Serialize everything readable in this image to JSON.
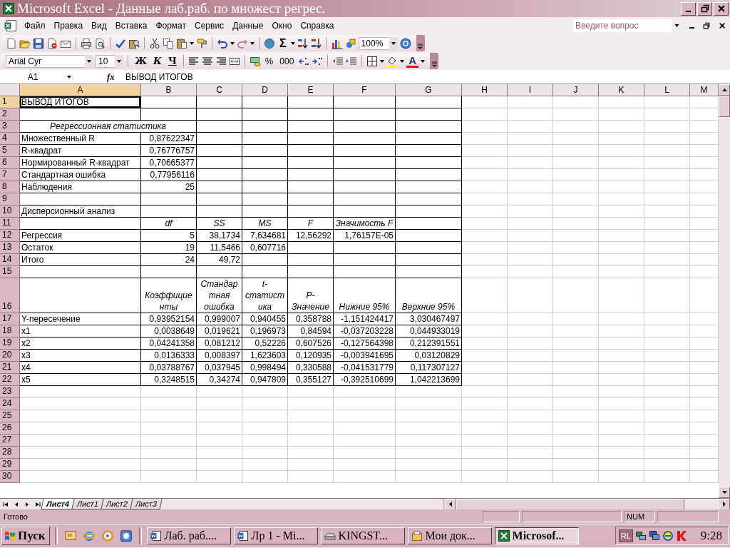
{
  "window": {
    "title": "Microsoft Excel - Данные лаб.раб. по множест регрес."
  },
  "menu": [
    "Файл",
    "Правка",
    "Вид",
    "Вставка",
    "Формат",
    "Сервис",
    "Данные",
    "Окно",
    "Справка"
  ],
  "help_box": {
    "placeholder": "Введите вопрос"
  },
  "standard_toolbar": {
    "sum": "Σ",
    "zoom": "100%"
  },
  "formatting_toolbar": {
    "font": "Arial Cyr",
    "size": "10",
    "bold": "Ж",
    "italic": "К",
    "underline": "Ч",
    "percent": "%",
    "thousands": "000",
    "font_color": "A"
  },
  "formula_bar": {
    "name_box": "A1",
    "function_label": "fx",
    "value": "ВЫВОД ИТОГОВ"
  },
  "sheet": {
    "columns": [
      {
        "label": "A",
        "selected": true
      },
      {
        "label": "B",
        "selected": false
      },
      {
        "label": "C",
        "selected": false
      },
      {
        "label": "D",
        "selected": false
      },
      {
        "label": "E",
        "selected": false
      },
      {
        "label": "F",
        "selected": false
      },
      {
        "label": "G",
        "selected": false
      },
      {
        "label": "H",
        "selected": false
      },
      {
        "label": "I",
        "selected": false
      },
      {
        "label": "J",
        "selected": false
      },
      {
        "label": "K",
        "selected": false
      },
      {
        "label": "L",
        "selected": false
      },
      {
        "label": "M",
        "selected": false
      }
    ],
    "rows": [
      {
        "number": "1",
        "selected": true,
        "framed": true,
        "cells": [
          {
            "text": "ВЫВОД ИТОГОВ",
            "kind": "text",
            "selected": true
          }
        ]
      },
      {
        "number": "2",
        "selected": false,
        "framed": true
      },
      {
        "number": "3",
        "selected": false,
        "framed": true,
        "cells": [
          {
            "text": "Регрессионная статистика",
            "kind": "title",
            "selected": false
          }
        ]
      },
      {
        "number": "4",
        "selected": false,
        "framed": true,
        "cells": [
          {
            "text": "Множественный R",
            "kind": "text",
            "selected": false
          },
          {
            "text": "0,87622347",
            "kind": "number",
            "selected": false
          }
        ]
      },
      {
        "number": "5",
        "selected": false,
        "framed": true,
        "cells": [
          {
            "text": "R-квадрат",
            "kind": "text",
            "selected": false
          },
          {
            "text": "0,76776757",
            "kind": "number",
            "selected": false
          }
        ]
      },
      {
        "number": "6",
        "selected": false,
        "framed": true,
        "cells": [
          {
            "text": "Нормированный R-квадрат",
            "kind": "text",
            "selected": false
          },
          {
            "text": "0,70665377",
            "kind": "number",
            "selected": false
          }
        ]
      },
      {
        "number": "7",
        "selected": false,
        "framed": true,
        "cells": [
          {
            "text": "Стандартная ошибка",
            "kind": "text",
            "selected": false
          },
          {
            "text": "0,77956116",
            "kind": "number",
            "selected": false
          }
        ]
      },
      {
        "number": "8",
        "selected": false,
        "framed": true,
        "cells": [
          {
            "text": "Наблюдения",
            "kind": "text",
            "selected": false
          },
          {
            "text": "25",
            "kind": "number",
            "selected": false
          }
        ]
      },
      {
        "number": "9",
        "selected": false,
        "framed": true
      },
      {
        "number": "10",
        "selected": false,
        "framed": true,
        "cells": [
          {
            "text": "Дисперсионный анализ",
            "kind": "text",
            "selected": false
          }
        ]
      },
      {
        "number": "11",
        "selected": false,
        "framed": true,
        "cells": [
          {
            "text": "",
            "kind": "text",
            "selected": false
          },
          {
            "text": "df",
            "kind": "heading",
            "selected": false
          },
          {
            "text": "SS",
            "kind": "heading",
            "selected": false
          },
          {
            "text": "MS",
            "kind": "heading",
            "selected": false
          },
          {
            "text": "F",
            "kind": "heading",
            "selected": false
          },
          {
            "text": "Значимость F",
            "kind": "heading",
            "selected": false
          }
        ]
      },
      {
        "number": "12",
        "selected": false,
        "framed": true,
        "cells": [
          {
            "text": "Регрессия",
            "kind": "text",
            "selected": false
          },
          {
            "text": "5",
            "kind": "number",
            "selected": false
          },
          {
            "text": "38,1734",
            "kind": "number",
            "selected": false
          },
          {
            "text": "7,634681",
            "kind": "number",
            "selected": false
          },
          {
            "text": "12,56292",
            "kind": "number",
            "selected": false
          },
          {
            "text": "1,76157E-05",
            "kind": "number",
            "selected": false
          }
        ]
      },
      {
        "number": "13",
        "selected": false,
        "framed": true,
        "cells": [
          {
            "text": "Остаток",
            "kind": "text",
            "selected": false
          },
          {
            "text": "19",
            "kind": "number",
            "selected": false
          },
          {
            "text": "11,5466",
            "kind": "number",
            "selected": false
          },
          {
            "text": "0,607716",
            "kind": "number",
            "selected": false
          }
        ]
      },
      {
        "number": "14",
        "selected": false,
        "framed": true,
        "cells": [
          {
            "text": "Итого",
            "kind": "text",
            "selected": false
          },
          {
            "text": "24",
            "kind": "number",
            "selected": false
          },
          {
            "text": "49,72",
            "kind": "number",
            "selected": false
          }
        ]
      },
      {
        "number": "15",
        "selected": false,
        "framed": true
      },
      {
        "number": "16",
        "selected": false,
        "framed": true,
        "cells": [
          {
            "text": "",
            "kind": "text",
            "selected": false
          },
          {
            "text": "Коэффициенты",
            "kind": "heading",
            "selected": false
          },
          {
            "text": "Стандартная ошибка",
            "kind": "heading",
            "selected": false
          },
          {
            "text": "t-статистика",
            "kind": "heading",
            "selected": false
          },
          {
            "text": "P-Значение",
            "kind": "heading",
            "selected": false
          },
          {
            "text": "Нижние 95%",
            "kind": "heading",
            "selected": false
          },
          {
            "text": "Верхние 95%",
            "kind": "heading",
            "selected": false
          }
        ]
      },
      {
        "number": "17",
        "selected": false,
        "framed": true,
        "cells": [
          {
            "text": "Y-пересечение",
            "kind": "text",
            "selected": false
          },
          {
            "text": "0,93952154",
            "kind": "number",
            "selected": false
          },
          {
            "text": "0,999007",
            "kind": "number",
            "selected": false
          },
          {
            "text": "0,940455",
            "kind": "number",
            "selected": false
          },
          {
            "text": "0,358788",
            "kind": "number",
            "selected": false
          },
          {
            "text": "-1,151424417",
            "kind": "number",
            "selected": false
          },
          {
            "text": "3,030467497",
            "kind": "number",
            "selected": false
          }
        ]
      },
      {
        "number": "18",
        "selected": false,
        "framed": true,
        "cells": [
          {
            "text": "x1",
            "kind": "text",
            "selected": false
          },
          {
            "text": "0,0038649",
            "kind": "number",
            "selected": false
          },
          {
            "text": "0,019621",
            "kind": "number",
            "selected": false
          },
          {
            "text": "0,196973",
            "kind": "number",
            "selected": false
          },
          {
            "text": "0,84594",
            "kind": "number",
            "selected": false
          },
          {
            "text": "-0,037203228",
            "kind": "number",
            "selected": false
          },
          {
            "text": "0,044933019",
            "kind": "number",
            "selected": false
          }
        ]
      },
      {
        "number": "19",
        "selected": false,
        "framed": true,
        "cells": [
          {
            "text": "x2",
            "kind": "text",
            "selected": false
          },
          {
            "text": "0,04241358",
            "kind": "number",
            "selected": false
          },
          {
            "text": "0,081212",
            "kind": "number",
            "selected": false
          },
          {
            "text": "0,52226",
            "kind": "number",
            "selected": false
          },
          {
            "text": "0,607526",
            "kind": "number",
            "selected": false
          },
          {
            "text": "-0,127564398",
            "kind": "number",
            "selected": false
          },
          {
            "text": "0,212391551",
            "kind": "number",
            "selected": false
          }
        ]
      },
      {
        "number": "20",
        "selected": false,
        "framed": true,
        "cells": [
          {
            "text": "x3",
            "kind": "text",
            "selected": false
          },
          {
            "text": "0,0136333",
            "kind": "number",
            "selected": false
          },
          {
            "text": "0,008397",
            "kind": "number",
            "selected": false
          },
          {
            "text": "1,623603",
            "kind": "number",
            "selected": false
          },
          {
            "text": "0,120935",
            "kind": "number",
            "selected": false
          },
          {
            "text": "-0,003941695",
            "kind": "number",
            "selected": false
          },
          {
            "text": "0,03120829",
            "kind": "number",
            "selected": false
          }
        ]
      },
      {
        "number": "21",
        "selected": false,
        "framed": true,
        "cells": [
          {
            "text": "x4",
            "kind": "text",
            "selected": false
          },
          {
            "text": "0,03788767",
            "kind": "number",
            "selected": false
          },
          {
            "text": "0,037945",
            "kind": "number",
            "selected": false
          },
          {
            "text": "0,998494",
            "kind": "number",
            "selected": false
          },
          {
            "text": "0,330588",
            "kind": "number",
            "selected": false
          },
          {
            "text": "-0,041531779",
            "kind": "number",
            "selected": false
          },
          {
            "text": "0,117307127",
            "kind": "number",
            "selected": false
          }
        ]
      },
      {
        "number": "22",
        "selected": false,
        "framed": true,
        "cells": [
          {
            "text": "x5",
            "kind": "text",
            "selected": false
          },
          {
            "text": "0,3248515",
            "kind": "number",
            "selected": false
          },
          {
            "text": "0,34274",
            "kind": "number",
            "selected": false
          },
          {
            "text": "0,947809",
            "kind": "number",
            "selected": false
          },
          {
            "text": "0,355127",
            "kind": "number",
            "selected": false
          },
          {
            "text": "-0,392510699",
            "kind": "number",
            "selected": false
          },
          {
            "text": "1,042213699",
            "kind": "number",
            "selected": false
          }
        ]
      },
      {
        "number": "23",
        "selected": false,
        "framed": false
      },
      {
        "number": "24",
        "selected": false,
        "framed": false
      },
      {
        "number": "25",
        "selected": false,
        "framed": false
      },
      {
        "number": "26",
        "selected": false,
        "framed": false
      },
      {
        "number": "27",
        "selected": false,
        "framed": false
      },
      {
        "number": "28",
        "selected": false,
        "framed": false
      },
      {
        "number": "29",
        "selected": false,
        "framed": false
      },
      {
        "number": "30",
        "selected": false,
        "framed": false
      }
    ]
  },
  "sheet_tabs": [
    {
      "label": "Лист4",
      "selected": true
    },
    {
      "label": "Лист1",
      "selected": false
    },
    {
      "label": "Лист2",
      "selected": false
    },
    {
      "label": "Лист3",
      "selected": false
    }
  ],
  "status_bar": {
    "text": "Готово",
    "indicator": "NUM"
  },
  "taskbar": {
    "start": "Пуск",
    "tasks": [
      {
        "label": "Лаб. раб....",
        "kind": "document",
        "selected": false
      },
      {
        "label": "Лр 1 - Mi...",
        "kind": "document",
        "selected": false
      },
      {
        "label": "KINGST...",
        "kind": "drive",
        "selected": false
      },
      {
        "label": "Мои док...",
        "kind": "folder",
        "selected": false
      },
      {
        "label": "Microsof...",
        "kind": "spreadsheet",
        "selected": true
      }
    ],
    "language": "RL",
    "clock": "9:28"
  }
}
